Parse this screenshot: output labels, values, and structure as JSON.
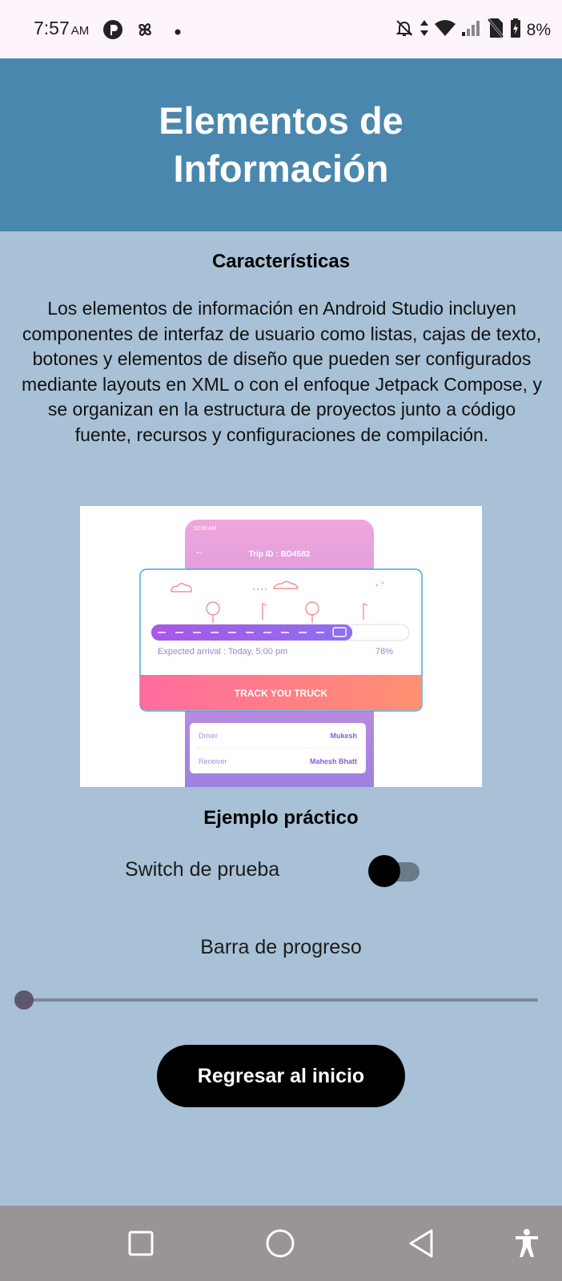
{
  "status_bar": {
    "time": "7:57",
    "ampm": "AM",
    "battery": "8%"
  },
  "header": {
    "title": "Elementos de Información"
  },
  "features": {
    "title": "Características",
    "description": "Los elementos de información en Android Studio incluyen componentes de interfaz de usuario como listas, cajas de texto, botones y elementos de diseño que pueden ser configurados mediante layouts en XML o con el enfoque Jetpack Compose, y se organizan en la estructura de proyectos junto a código fuente, recursos y configuraciones de compilación."
  },
  "illustration": {
    "phone_time": "10:00 AM",
    "trip_id": "Trip ID : BD4582",
    "arrival": "Expected arrival : Today, 5:00 pm",
    "percent": "78%",
    "progress": 0.78,
    "cta": "TRACK YOU TRUCK",
    "rows": [
      {
        "label": "Driver",
        "value": "Mukesh"
      },
      {
        "label": "Receiver",
        "value": "Mahesh Bhatt"
      }
    ]
  },
  "example": {
    "title": "Ejemplo práctico",
    "switch_label": "Switch de prueba",
    "switch_on": false,
    "progress_label": "Barra de progreso",
    "slider_value": 0.0,
    "button_label": "Regresar al inicio"
  },
  "icons": {
    "status_left": [
      "app-p-icon",
      "pinwheel-icon",
      "dot-icon"
    ],
    "status_right": [
      "bell-off-icon",
      "data-arrows-icon",
      "wifi-icon",
      "signal-icon",
      "no-sim-icon",
      "battery-icon"
    ],
    "nav": [
      "square-recent-icon",
      "circle-home-icon",
      "triangle-back-icon",
      "accessibility-icon"
    ]
  },
  "colors": {
    "background": "#a8c1d6",
    "header": "#4a87ae",
    "button": "#000000",
    "status_bar": "#fdf5fb",
    "nav_bar": "#989498"
  }
}
